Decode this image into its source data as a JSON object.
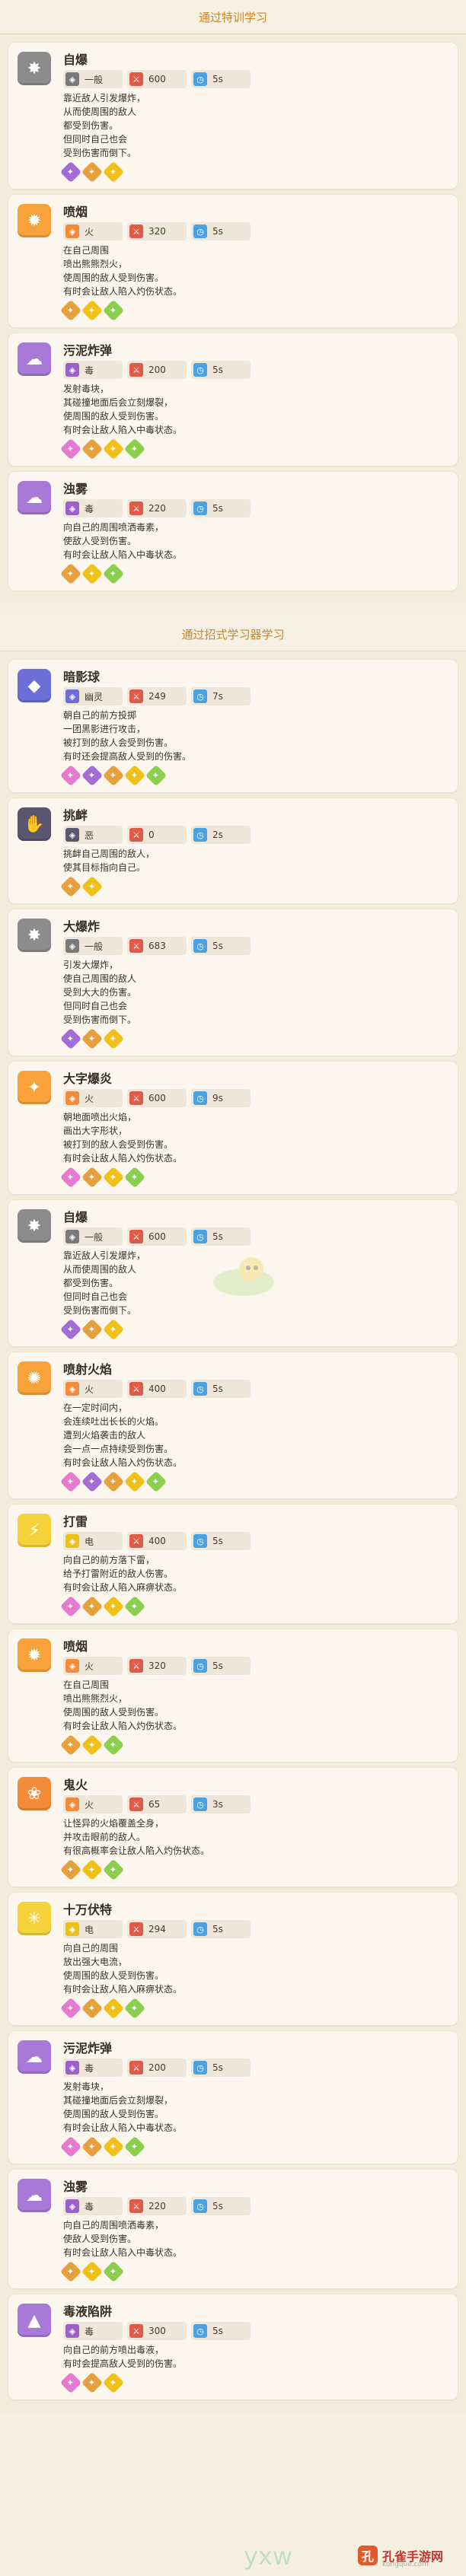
{
  "sections": [
    {
      "title": "通过特训学习",
      "skills": [
        {
          "name": "自爆",
          "icon": "explosion-icon",
          "icon_color": "#8c8c8c",
          "type": "一般",
          "type_color": "#7a7a7a",
          "power": "600",
          "pp": "5s",
          "desc": "靠近敌人引发爆炸，\n从而使周围的敌人\n都受到伤害。\n但同时自己也会\n受到伤害而倒下。",
          "effects": [
            "#a36bd6",
            "#e8a03c",
            "#f1c11a"
          ]
        },
        {
          "name": "喷烟",
          "icon": "flame-burst-icon",
          "icon_color": "#f7a23a",
          "type": "火",
          "type_color": "#f28b3a",
          "power": "320",
          "pp": "5s",
          "desc": "在自己周围\n喷出熊熊烈火，\n使周围的敌人受到伤害。\n有时会让敌人陷入灼伤状态。",
          "effects": [
            "#e8a03c",
            "#f1c11a",
            "#8bcf4e"
          ]
        },
        {
          "name": "污泥炸弹",
          "icon": "sludge-icon",
          "icon_color": "#a879d6",
          "type": "毒",
          "type_color": "#9b61c9",
          "power": "200",
          "pp": "5s",
          "desc": "发射毒块，\n其碰撞地面后会立刻爆裂，\n使周围的敌人受到伤害。\n有时会让敌人陷入中毒状态。",
          "effects": [
            "#e57ad0",
            "#e8a03c",
            "#f1c11a",
            "#8bcf4e"
          ]
        },
        {
          "name": "浊雾",
          "icon": "smog-icon",
          "icon_color": "#a879d6",
          "type": "毒",
          "type_color": "#9b61c9",
          "power": "220",
          "pp": "5s",
          "desc": "向自己的周围喷洒毒素，\n使敌人受到伤害。\n有时会让敌人陷入中毒状态。",
          "effects": [
            "#e8a03c",
            "#f1c11a",
            "#8bcf4e"
          ]
        }
      ]
    },
    {
      "title": "通过招式学习器学习",
      "skills": [
        {
          "name": "暗影球",
          "icon": "shadow-ball-icon",
          "icon_color": "#6d6fd6",
          "type": "幽灵",
          "type_color": "#6d6fd6",
          "power": "249",
          "pp": "7s",
          "desc": "朝自己的前方投掷\n一团黑影进行攻击，\n被打到的敌人会受到伤害。\n有时还会提高敌人受到的伤害。",
          "effects": [
            "#e57ad0",
            "#a36bd6",
            "#e8a03c",
            "#f1c11a",
            "#8bcf4e"
          ]
        },
        {
          "name": "挑衅",
          "icon": "taunt-icon",
          "icon_color": "#5a5670",
          "type": "恶",
          "type_color": "#5a5670",
          "power": "0",
          "pp": "2s",
          "desc": "挑衅自己周围的敌人，\n使其目标指向自己。",
          "effects": [
            "#e8a03c",
            "#f1c11a"
          ]
        },
        {
          "name": "大爆炸",
          "icon": "big-explosion-icon",
          "icon_color": "#8c8c8c",
          "type": "一般",
          "type_color": "#7a7a7a",
          "power": "683",
          "pp": "5s",
          "desc": "引发大爆炸，\n使自己周围的敌人\n受到大大的伤害。\n但同时自己也会\n受到伤害而倒下。",
          "effects": [
            "#a36bd6",
            "#e8a03c",
            "#f1c11a"
          ]
        },
        {
          "name": "大字爆炎",
          "icon": "fire-blast-icon",
          "icon_color": "#f7a23a",
          "type": "火",
          "type_color": "#f28b3a",
          "power": "600",
          "pp": "9s",
          "desc": "朝地面喷出火焰，\n画出大字形状，\n被打到的敌人会受到伤害。\n有时会让敌人陷入灼伤状态。",
          "effects": [
            "#e57ad0",
            "#e8a03c",
            "#f1c11a",
            "#8bcf4e"
          ]
        },
        {
          "name": "自爆",
          "icon": "explosion-icon",
          "icon_color": "#8c8c8c",
          "type": "一般",
          "type_color": "#7a7a7a",
          "power": "600",
          "pp": "5s",
          "desc": "靠近敌人引发爆炸，\n从而使周围的敌人\n都受到伤害。\n但同时自己也会\n受到伤害而倒下。",
          "effects": [
            "#a36bd6",
            "#e8a03c",
            "#f1c11a"
          ]
        },
        {
          "name": "喷射火焰",
          "icon": "flamethrower-icon",
          "icon_color": "#f7a23a",
          "type": "火",
          "type_color": "#f28b3a",
          "power": "400",
          "pp": "5s",
          "desc": "在一定时间内，\n会连续吐出长长的火焰。\n遭到火焰袭击的敌人\n会一点一点持续受到伤害。\n有时会让敌人陷入灼伤状态。",
          "effects": [
            "#e57ad0",
            "#a36bd6",
            "#e8a03c",
            "#f1c11a",
            "#8bcf4e"
          ]
        },
        {
          "name": "打雷",
          "icon": "thunder-icon",
          "icon_color": "#f3d23a",
          "type": "电",
          "type_color": "#e9c21a",
          "power": "400",
          "pp": "5s",
          "desc": "向自己的前方落下雷，\n给予打雷附近的敌人伤害。\n有时会让敌人陷入麻痹状态。",
          "effects": [
            "#e57ad0",
            "#e8a03c",
            "#f1c11a",
            "#8bcf4e"
          ]
        },
        {
          "name": "喷烟",
          "icon": "flame-burst-icon",
          "icon_color": "#f7a23a",
          "type": "火",
          "type_color": "#f28b3a",
          "power": "320",
          "pp": "5s",
          "desc": "在自己周围\n喷出熊熊烈火，\n使周围的敌人受到伤害。\n有时会让敌人陷入灼伤状态。",
          "effects": [
            "#e8a03c",
            "#f1c11a",
            "#8bcf4e"
          ]
        },
        {
          "name": "鬼火",
          "icon": "will-o-wisp-icon",
          "icon_color": "#f28b3a",
          "type": "火",
          "type_color": "#f28b3a",
          "power": "65",
          "pp": "3s",
          "desc": "让怪异的火焰覆盖全身，\n并攻击眼前的敌人。\n有很高概率会让敌人陷入灼伤状态。",
          "effects": [
            "#e8a03c",
            "#f1c11a",
            "#8bcf4e"
          ]
        },
        {
          "name": "十万伏特",
          "icon": "thunderbolt-icon",
          "icon_color": "#f3d23a",
          "type": "电",
          "type_color": "#e9c21a",
          "power": "294",
          "pp": "5s",
          "desc": "向自己的周围\n放出强大电流，\n使周围的敌人受到伤害。\n有时会让敌人陷入麻痹状态。",
          "effects": [
            "#e57ad0",
            "#e8a03c",
            "#f1c11a",
            "#8bcf4e"
          ]
        },
        {
          "name": "污泥炸弹",
          "icon": "sludge-icon",
          "icon_color": "#a879d6",
          "type": "毒",
          "type_color": "#9b61c9",
          "power": "200",
          "pp": "5s",
          "desc": "发射毒块，\n其碰撞地面后会立刻爆裂，\n使周围的敌人受到伤害。\n有时会让敌人陷入中毒状态。",
          "effects": [
            "#e57ad0",
            "#e8a03c",
            "#f1c11a",
            "#8bcf4e"
          ]
        },
        {
          "name": "浊雾",
          "icon": "smog-icon",
          "icon_color": "#a879d6",
          "type": "毒",
          "type_color": "#9b61c9",
          "power": "220",
          "pp": "5s",
          "desc": "向自己的周围喷洒毒素，\n使敌人受到伤害。\n有时会让敌人陷入中毒状态。",
          "effects": [
            "#e8a03c",
            "#f1c11a",
            "#8bcf4e"
          ]
        },
        {
          "name": "毒液陷阱",
          "icon": "toxic-spikes-icon",
          "icon_color": "#a879d6",
          "type": "毒",
          "type_color": "#9b61c9",
          "power": "300",
          "pp": "5s",
          "desc": "向自己的前方喷出毒液，\n有时会提高敌人受到的伤害。",
          "effects": [
            "#e57ad0",
            "#e8a03c",
            "#f1c11a"
          ]
        }
      ]
    }
  ],
  "brand": {
    "name": "孔雀手游网",
    "url": "kongque.com",
    "mark": "孔",
    "wm": "yxw"
  },
  "stat_icons": {
    "power": "#e05a4a",
    "pp": "#4aa3e0"
  }
}
